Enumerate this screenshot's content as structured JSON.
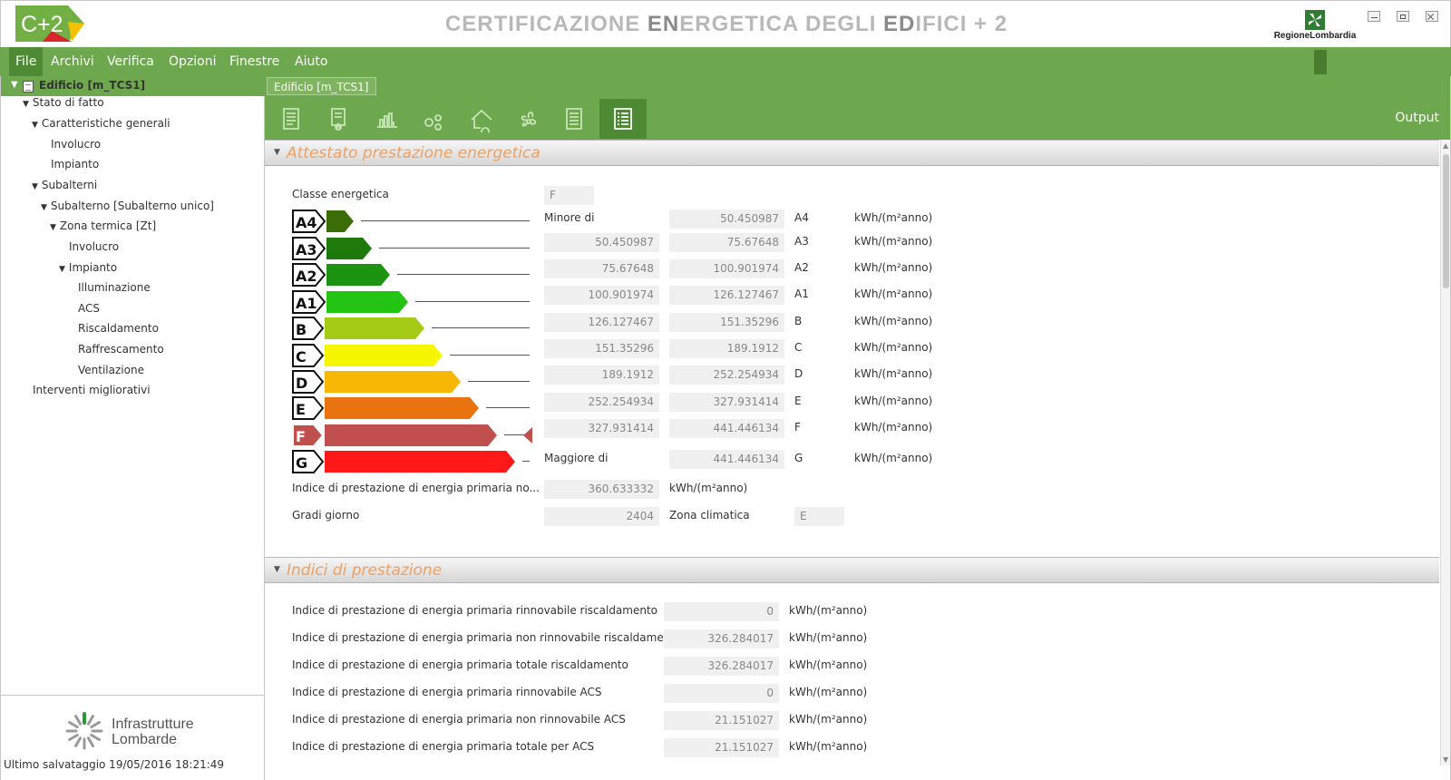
{
  "window": {
    "logo_text": "C+2",
    "title_parts": [
      {
        "text": "C",
        "dark": false
      },
      {
        "text": "ERTIFICAZIONE ",
        "dark": false
      },
      {
        "text": "EN",
        "dark": true
      },
      {
        "text": "ERGETICA DEGLI ",
        "dark": false
      },
      {
        "text": "ED",
        "dark": true
      },
      {
        "text": "IFICI + 2",
        "dark": false
      }
    ],
    "region_logo_text": "RegioneLombardia"
  },
  "menu": [
    "File",
    "Archivi",
    "Verifica",
    "Opzioni",
    "Finestre",
    "Aiuto"
  ],
  "sidebar": {
    "root_label": "Edificio [m_TCS1]",
    "items": [
      {
        "label": "Stato di fatto",
        "expanded": true
      },
      {
        "label": "Caratteristiche generali",
        "expanded": true
      },
      {
        "label": "Involucro",
        "expanded": false
      },
      {
        "label": "Impianto",
        "expanded": false
      },
      {
        "label": "Subalterni",
        "expanded": true
      },
      {
        "label": "Subalterno [Subalterno unico]",
        "expanded": true
      },
      {
        "label": "Zona termica [Zt]",
        "expanded": true
      },
      {
        "label": "Involucro",
        "expanded": false
      },
      {
        "label": "Impianto",
        "expanded": true
      },
      {
        "label": "Illuminazione",
        "expanded": false
      },
      {
        "label": "ACS",
        "expanded": false
      },
      {
        "label": "Riscaldamento",
        "expanded": false
      },
      {
        "label": "Raffrescamento",
        "expanded": false
      },
      {
        "label": "Ventilazione",
        "expanded": false
      },
      {
        "label": "Interventi migliorativi",
        "expanded": false
      }
    ],
    "footer_logo_line1": "Infrastrutture",
    "footer_logo_line2": "Lombarde",
    "last_save": "Ultimo salvataggio 19/05/2016 18:21:49"
  },
  "main": {
    "doc_tab": "Edificio [m_TCS1]",
    "toolbar_icons": [
      "document-icon",
      "certificate-icon",
      "chart-icon",
      "gears-icon",
      "house-icon",
      "fan-icon",
      "list-icon",
      "output-list-icon"
    ],
    "output_label": "Output"
  },
  "ape": {
    "section_title": "Attestato prestazione energetica",
    "classe_label": "Classe energetica",
    "classe_value": "F",
    "unit": "kWh/(m²anno)",
    "classes": [
      {
        "class": "A4",
        "color": "#3a6d08",
        "from": "Minore di",
        "to": "50.450987"
      },
      {
        "class": "A3",
        "color": "#1f7a0c",
        "from": "50.450987",
        "to": "75.67648"
      },
      {
        "class": "A2",
        "color": "#1c9412",
        "from": "75.67648",
        "to": "100.901974"
      },
      {
        "class": "A1",
        "color": "#23c414",
        "from": "100.901974",
        "to": "126.127467"
      },
      {
        "class": "B",
        "color": "#a4cc16",
        "from": "126.127467",
        "to": "151.35296"
      },
      {
        "class": "C",
        "color": "#f6f600",
        "from": "151.35296",
        "to": "189.1912"
      },
      {
        "class": "D",
        "color": "#f7b705",
        "from": "189.1912",
        "to": "252.254934"
      },
      {
        "class": "E",
        "color": "#e8730f",
        "from": "252.254934",
        "to": "327.931414"
      },
      {
        "class": "F",
        "color": "#c0504d",
        "from": "327.931414",
        "to": "441.446134"
      },
      {
        "class": "G",
        "color": "#ff1818",
        "from": "Maggiore di",
        "to": "441.446134"
      }
    ],
    "indice_label": "Indice di prestazione di energia primaria no...",
    "indice_value": "360.633332",
    "indice_unit": "kWh/(m²anno)",
    "gradi_label": "Gradi giorno",
    "gradi_value": "2404",
    "zona_label": "Zona climatica",
    "zona_value": "E"
  },
  "indici": {
    "section_title": "Indici di prestazione",
    "unit": "kWh/(m²anno)",
    "rows": [
      {
        "label": "Indice di prestazione di energia primaria rinnovabile riscaldamento",
        "value": "0"
      },
      {
        "label": "Indice di prestazione di energia primaria non rinnovabile riscaldamento",
        "value": "326.284017"
      },
      {
        "label": "Indice di prestazione di energia primaria totale riscaldamento",
        "value": "326.284017"
      },
      {
        "label": "Indice di prestazione di energia primaria rinnovabile ACS",
        "value": "0"
      },
      {
        "label": "Indice di prestazione di energia primaria non rinnovabile ACS",
        "value": "21.151027"
      },
      {
        "label": "Indice di prestazione di energia primaria totale per ACS",
        "value": "21.151027"
      }
    ]
  }
}
